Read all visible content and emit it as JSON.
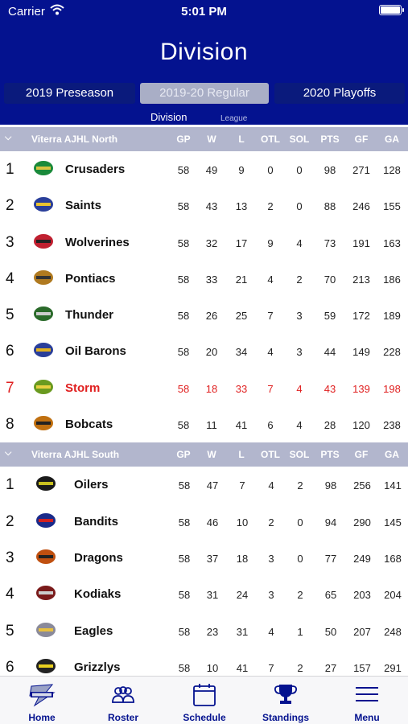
{
  "status_bar": {
    "carrier": "Carrier",
    "time": "5:01 PM"
  },
  "page_title": "Division",
  "seasons": [
    {
      "label": "2019 Preseason",
      "active": false
    },
    {
      "label": "2019-20 Regular",
      "active": true
    },
    {
      "label": "2020 Playoffs",
      "active": false
    }
  ],
  "subtabs": {
    "division": "Division",
    "league": "League"
  },
  "columns": [
    "GP",
    "W",
    "L",
    "OTL",
    "SOL",
    "PTS",
    "GF",
    "GA"
  ],
  "colors": {
    "header_bg": "#04128f",
    "group_bg": "#b2b6cd",
    "highlight": "#e02020",
    "accent": "#04128f"
  },
  "groups": [
    {
      "name": "Viterra AJHL North",
      "rows": [
        {
          "rank": "1",
          "team": "Crusaders",
          "logo_icon": "crusaders-logo-icon",
          "stats": [
            "58",
            "49",
            "9",
            "0",
            "0",
            "98",
            "271",
            "128"
          ]
        },
        {
          "rank": "2",
          "team": "Saints",
          "logo_icon": "saints-logo-icon",
          "stats": [
            "58",
            "43",
            "13",
            "2",
            "0",
            "88",
            "246",
            "155"
          ]
        },
        {
          "rank": "3",
          "team": "Wolverines",
          "logo_icon": "wolverines-logo-icon",
          "stats": [
            "58",
            "32",
            "17",
            "9",
            "4",
            "73",
            "191",
            "163"
          ]
        },
        {
          "rank": "4",
          "team": "Pontiacs",
          "logo_icon": "pontiacs-logo-icon",
          "stats": [
            "58",
            "33",
            "21",
            "4",
            "2",
            "70",
            "213",
            "186"
          ]
        },
        {
          "rank": "5",
          "team": "Thunder",
          "logo_icon": "thunder-logo-icon",
          "stats": [
            "58",
            "26",
            "25",
            "7",
            "3",
            "59",
            "172",
            "189"
          ]
        },
        {
          "rank": "6",
          "team": "Oil Barons",
          "logo_icon": "oil-barons-logo-icon",
          "stats": [
            "58",
            "20",
            "34",
            "4",
            "3",
            "44",
            "149",
            "228"
          ]
        },
        {
          "rank": "7",
          "team": "Storm",
          "logo_icon": "storm-logo-icon",
          "highlight": true,
          "stats": [
            "58",
            "18",
            "33",
            "7",
            "4",
            "43",
            "139",
            "198"
          ]
        },
        {
          "rank": "8",
          "team": "Bobcats",
          "logo_icon": "bobcats-logo-icon",
          "stats": [
            "58",
            "11",
            "41",
            "6",
            "4",
            "28",
            "120",
            "238"
          ]
        }
      ]
    },
    {
      "name": "Viterra AJHL South",
      "rows": [
        {
          "rank": "1",
          "team": "Oilers",
          "logo_icon": "oilers-logo-icon",
          "stats": [
            "58",
            "47",
            "7",
            "4",
            "2",
            "98",
            "256",
            "141"
          ]
        },
        {
          "rank": "2",
          "team": "Bandits",
          "logo_icon": "bandits-logo-icon",
          "stats": [
            "58",
            "46",
            "10",
            "2",
            "0",
            "94",
            "290",
            "145"
          ]
        },
        {
          "rank": "3",
          "team": "Dragons",
          "logo_icon": "dragons-logo-icon",
          "stats": [
            "58",
            "37",
            "18",
            "3",
            "0",
            "77",
            "249",
            "168"
          ]
        },
        {
          "rank": "4",
          "team": "Kodiaks",
          "logo_icon": "kodiaks-logo-icon",
          "stats": [
            "58",
            "31",
            "24",
            "3",
            "2",
            "65",
            "203",
            "204"
          ]
        },
        {
          "rank": "5",
          "team": "Eagles",
          "logo_icon": "eagles-logo-icon",
          "stats": [
            "58",
            "23",
            "31",
            "4",
            "1",
            "50",
            "207",
            "248"
          ]
        },
        {
          "rank": "6",
          "team": "Grizzlys",
          "logo_icon": "grizzlys-logo-icon",
          "stats": [
            "58",
            "10",
            "41",
            "7",
            "2",
            "27",
            "157",
            "291"
          ]
        }
      ]
    }
  ],
  "tabbar": [
    {
      "label": "Home",
      "icon": "storm-logo-icon"
    },
    {
      "label": "Roster",
      "icon": "people-icon"
    },
    {
      "label": "Schedule",
      "icon": "calendar-icon"
    },
    {
      "label": "Standings",
      "icon": "trophy-icon"
    },
    {
      "label": "Menu",
      "icon": "hamburger-menu-icon"
    }
  ]
}
